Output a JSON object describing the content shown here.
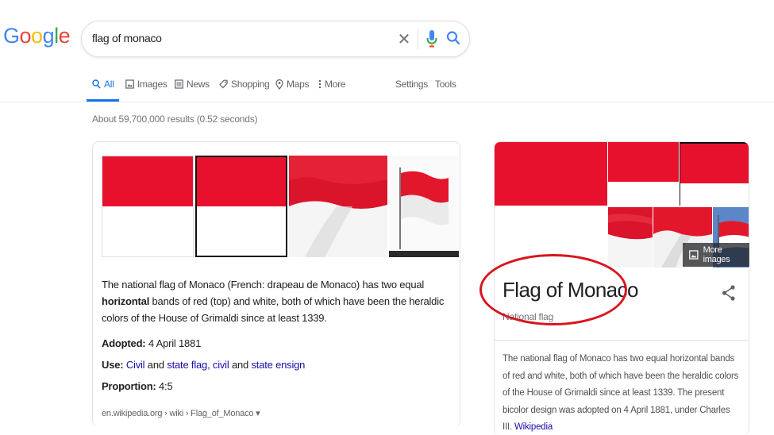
{
  "logo": {
    "letters": [
      "G",
      "o",
      "o",
      "g",
      "l",
      "e"
    ],
    "colors": [
      "#4285f4",
      "#ea4335",
      "#fbbc05",
      "#4285f4",
      "#34a853",
      "#ea4335"
    ]
  },
  "search": {
    "query": "flag of monaco"
  },
  "tabs": [
    {
      "label": "All",
      "icon": "search-icon"
    },
    {
      "label": "Images",
      "icon": "image-icon"
    },
    {
      "label": "News",
      "icon": "news-icon"
    },
    {
      "label": "Shopping",
      "icon": "tag-icon"
    },
    {
      "label": "Maps",
      "icon": "map-pin-icon"
    },
    {
      "label": "More",
      "icon": "kebab-icon"
    }
  ],
  "tools": {
    "settings": "Settings",
    "tools": "Tools"
  },
  "result_stats": "About 59,700,000 results (0.52 seconds)",
  "left_card": {
    "desc_pre": "The national flag of Monaco (French: drapeau de Monaco) has two equal ",
    "desc_bold": "horizontal",
    "desc_post": " bands of red (top) and white, both of which have been the heraldic colors of the House of Grimaldi since at least 1339.",
    "adopted_label": "Adopted:",
    "adopted_value": "4 April 1881",
    "use_label": "Use:",
    "use_civil": "Civil",
    "use_and1": "and",
    "use_state_flag": "state flag, civil",
    "use_and2": "and",
    "use_state_ensign": "state ensign",
    "proportion_label": "Proportion:",
    "proportion_value": "4:5",
    "source": "en.wikipedia.org › wiki › Flag_of_Monaco ▾"
  },
  "knowledge_panel": {
    "more_images": "More images",
    "title": "Flag of Monaco",
    "subtitle": "National flag",
    "description": "The national flag of Monaco has two equal horizontal bands of red and white, both of which have been the heraldic colors of the House of Grimaldi since at least 1339. The present bicolor design was adopted on 4 April 1881, under Charles III.",
    "source_link": "Wikipedia"
  },
  "colors": {
    "accent": "#1a73e8",
    "flag_red": "#e8112d",
    "link": "#1a0dab",
    "annotation": "#d9141e"
  }
}
